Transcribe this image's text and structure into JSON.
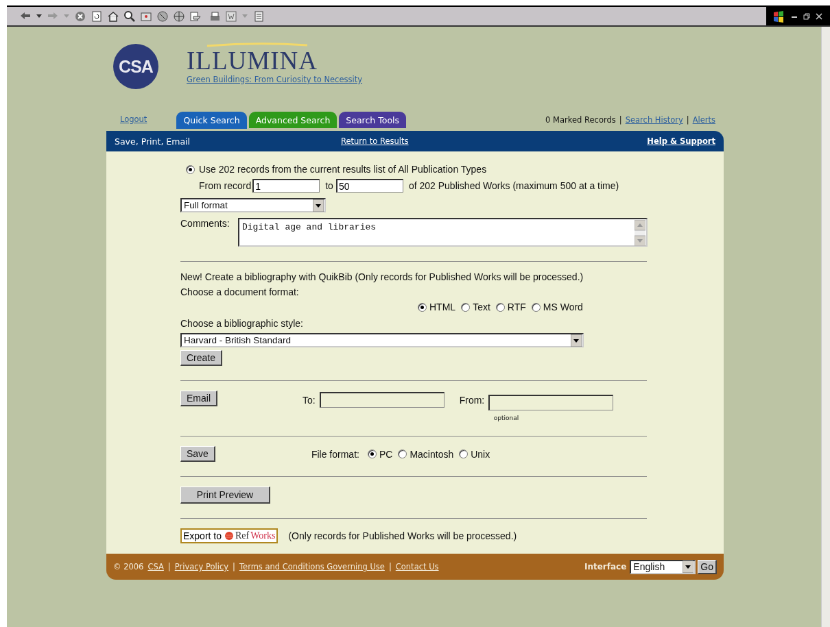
{
  "header": {
    "logo_text": "CSA",
    "title": "ILLUMINA",
    "subtitle": "Green Buildings: From Curiosity to Necessity"
  },
  "nav": {
    "logout": "Logout",
    "tabs": [
      {
        "label": "Quick Search",
        "color": "#1a63b8",
        "selected": true
      },
      {
        "label": "Advanced Search",
        "color": "#2f9a1a",
        "selected": false
      },
      {
        "label": "Search Tools",
        "color": "#4a3a9a",
        "selected": false
      }
    ],
    "links": [
      {
        "text": "0 Marked Records",
        "kind": "text"
      },
      {
        "text": "|",
        "kind": "separator"
      },
      {
        "text": "Search History",
        "kind": "link"
      },
      {
        "text": "|",
        "kind": "separator"
      },
      {
        "text": "Alerts",
        "kind": "link"
      }
    ]
  },
  "bar": {
    "title": "Save, Print, Email",
    "center_link": "Return to Results",
    "help_link": "Help & Support"
  },
  "records": {
    "label": "Use 202 records from the current results list of All Publication Types",
    "selected": true,
    "from_label": "From record",
    "from_value": "1",
    "to_label": "to",
    "to_value": "50",
    "note": "of 202 Published Works (maximum 500 at a time)"
  },
  "format_select": "Full format",
  "comments": {
    "label": "Comments:",
    "value": "Digital age and libraries"
  },
  "quikbib": {
    "intro": "New! Create a bibliography with QuikBib (Only records for Published Works will be processed.)",
    "format_label": "Choose a document format:",
    "formats": [
      {
        "label": "HTML",
        "selected": true
      },
      {
        "label": "Text",
        "selected": false
      },
      {
        "label": "RTF",
        "selected": false
      },
      {
        "label": "MS Word",
        "selected": false
      }
    ],
    "style_label": "Choose a bibliographic style:",
    "style_select": "Harvard - British Standard",
    "create_button": "Create"
  },
  "email": {
    "button": "Email",
    "to_label": "To:",
    "from_label": "From:",
    "optional": "optional"
  },
  "save": {
    "button": "Save",
    "label": "File format:",
    "formats": [
      {
        "label": "PC",
        "selected": true
      },
      {
        "label": "Macintosh",
        "selected": false
      },
      {
        "label": "Unix",
        "selected": false
      }
    ]
  },
  "print_button": "Print Preview",
  "export": {
    "prefix": "Export to",
    "brand_1": "Ref",
    "brand_2": "Works",
    "note": "(Only records for Published Works will be processed.)"
  },
  "footer": {
    "items": [
      {
        "text": "© 2006",
        "kind": "text"
      },
      {
        "text": "CSA",
        "kind": "link"
      },
      {
        "text": "|",
        "kind": "separator"
      },
      {
        "text": "Privacy Policy",
        "kind": "link"
      },
      {
        "text": "|",
        "kind": "separator"
      },
      {
        "text": "Terms and Conditions Governing Use",
        "kind": "link"
      },
      {
        "text": "|",
        "kind": "separator"
      },
      {
        "text": "Contact Us",
        "kind": "link"
      }
    ],
    "interface_label": "Interface",
    "language": "English",
    "go_button": "Go"
  }
}
